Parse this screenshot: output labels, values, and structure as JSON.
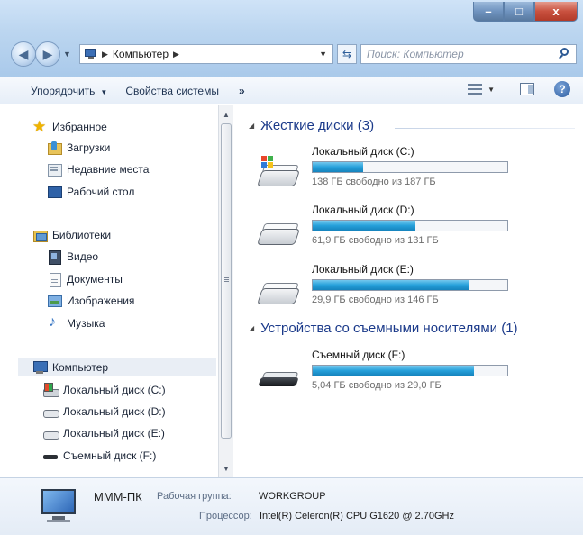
{
  "window": {
    "caption_buttons": [
      "–",
      "□",
      "x"
    ]
  },
  "navigation": {
    "address_path": "Компьютер",
    "search_placeholder": "Поиск: Компьютер"
  },
  "toolbar": {
    "organize_label": "Упорядочить",
    "system_properties_label": "Свойства системы",
    "more_label": "»"
  },
  "sidebar": {
    "favorites_label": "Избранное",
    "favorites": [
      "Загрузки",
      "Недавние места",
      "Рабочий стол"
    ],
    "libraries_label": "Библиотеки",
    "libraries": [
      "Видео",
      "Документы",
      "Изображения",
      "Музыка"
    ],
    "computer_label": "Компьютер",
    "computer_items": [
      "Локальный диск (C:)",
      "Локальный диск (D:)",
      "Локальный диск (E:)",
      "Съемный диск (F:)"
    ]
  },
  "content": {
    "hard_disks_header": "Жесткие диски (3)",
    "removable_header": "Устройства со съемными носителями (1)",
    "drives": [
      {
        "name": "Локальный диск (C:)",
        "free_text": "138 ГБ свободно из 187 ГБ",
        "used_fraction": 0.26,
        "icon": "system-drive-icon"
      },
      {
        "name": "Локальный диск (D:)",
        "free_text": "61,9 ГБ свободно из 131 ГБ",
        "used_fraction": 0.53,
        "icon": "hard-drive-icon"
      },
      {
        "name": "Локальный диск (E:)",
        "free_text": "29,9 ГБ свободно из 146 ГБ",
        "used_fraction": 0.8,
        "icon": "hard-drive-icon"
      }
    ],
    "removable": [
      {
        "name": "Съемный диск (F:)",
        "free_text": "5,04 ГБ свободно из 29,0 ГБ",
        "used_fraction": 0.83,
        "icon": "removable-drive-icon"
      }
    ]
  },
  "details": {
    "computer_name": "МММ-ПК",
    "workgroup_label": "Рабочая группа:",
    "workgroup_value": "WORKGROUP",
    "processor_label": "Процессор:",
    "processor_value": "Intel(R) Celeron(R) CPU G1620 @ 2.70GHz"
  },
  "colors": {
    "header_blue": "#1b3a8a",
    "bar_fill": "#26a0da"
  }
}
